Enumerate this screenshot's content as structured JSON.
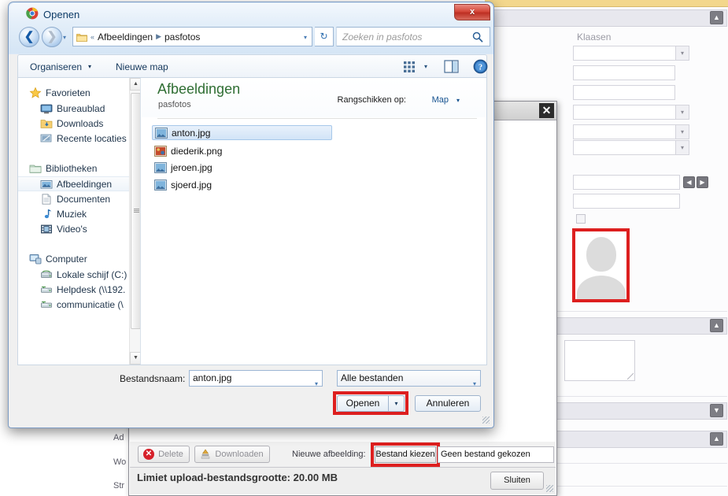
{
  "dialog": {
    "title": "Openen",
    "ghost_title_text": "",
    "close_label": "x",
    "nav": {
      "back_icon": "back-arrow-icon",
      "forward_icon": "forward-arrow-icon",
      "history_caret": "▾",
      "breadcrumb_prefix": "«",
      "breadcrumb": [
        "Afbeeldingen",
        "pasfotos"
      ],
      "breadcrumb_sep": "▶",
      "address_caret": "▾",
      "refresh_icon": "↻",
      "search_placeholder": "Zoeken in pasfotos"
    },
    "commandbar": {
      "organize_label": "Organiseren",
      "organize_caret": "▾",
      "new_folder_label": "Nieuwe map",
      "view_caret": "▾"
    },
    "navpane": {
      "groups": [
        {
          "label": "Favorieten",
          "icon": "star-icon",
          "items": [
            {
              "label": "Bureaublad",
              "icon": "desktop-icon"
            },
            {
              "label": "Downloads",
              "icon": "downloads-folder-icon"
            },
            {
              "label": "Recente locaties",
              "icon": "recent-locations-icon"
            }
          ]
        },
        {
          "label": "Bibliotheken",
          "icon": "libraries-icon",
          "items": [
            {
              "label": "Afbeeldingen",
              "icon": "pictures-library-icon",
              "selected": true
            },
            {
              "label": "Documenten",
              "icon": "documents-library-icon"
            },
            {
              "label": "Muziek",
              "icon": "music-library-icon"
            },
            {
              "label": "Video's",
              "icon": "video-library-icon"
            }
          ]
        },
        {
          "label": "Computer",
          "icon": "computer-icon",
          "items": [
            {
              "label": "Lokale schijf (C:)",
              "icon": "hard-drive-icon"
            },
            {
              "label": "Helpdesk (\\\\192.",
              "icon": "network-drive-icon"
            },
            {
              "label": "communicatie (\\",
              "icon": "network-drive-icon"
            }
          ]
        }
      ]
    },
    "listpane": {
      "title": "Afbeeldingen",
      "subtitle": "pasfotos",
      "arrange_label": "Rangschikken op:",
      "arrange_value": "Map",
      "arrange_caret": "▾",
      "files": [
        {
          "name": "anton.jpg",
          "icon": "jpg-image-icon",
          "selected": true
        },
        {
          "name": "diederik.png",
          "icon": "png-image-icon",
          "selected": false
        },
        {
          "name": "jeroen.jpg",
          "icon": "jpg-image-icon",
          "selected": false
        },
        {
          "name": "sjoerd.jpg",
          "icon": "jpg-image-icon",
          "selected": false
        }
      ]
    },
    "footer": {
      "filename_label": "Bestandsnaam:",
      "filename_value": "anton.jpg",
      "filename_caret": "▾",
      "filetype_value": "Alle bestanden",
      "filetype_caret": "▾",
      "open_label": "Openen",
      "open_split_caret": "▾",
      "cancel_label": "Annuleren"
    }
  },
  "upload_modal": {
    "close_label": "✕",
    "delete_label": "Delete",
    "download_label": "Downloaden",
    "new_image_label": "Nieuwe afbeelding:",
    "choose_file_label": "Bestand kiezen",
    "no_file_label": "Geen bestand gekozen",
    "limit_text": "Limiet upload-bestandsgrootte: 20.00 MB",
    "close_button_label": "Sluiten"
  },
  "background_page": {
    "right_panel": {
      "classes_label": "Klaasen",
      "collapse_caret_up": "▲",
      "collapse_caret_down": "▼",
      "field_caret": "▾",
      "prev_arrow": "◀",
      "next_arrow": "▶",
      "fields": [
        {
          "type": "select",
          "value": ""
        },
        {
          "type": "text",
          "value": ""
        },
        {
          "type": "text",
          "value": ""
        },
        {
          "type": "select",
          "value": ""
        },
        {
          "type": "select",
          "value": ""
        },
        {
          "type": "select",
          "value": ""
        }
      ],
      "paged_field_value": "",
      "extra_field_value": "",
      "textarea_value": ""
    },
    "left_form_rows": [
      "Ad",
      "Wo",
      "Str"
    ]
  },
  "colors": {
    "highlight_red": "#dd1f1f",
    "dialog_title_blue": "#0d3b66",
    "folder_title_green": "#2f6e33",
    "link_blue": "#15528f",
    "top_strip_gold": "#f3d78c"
  }
}
